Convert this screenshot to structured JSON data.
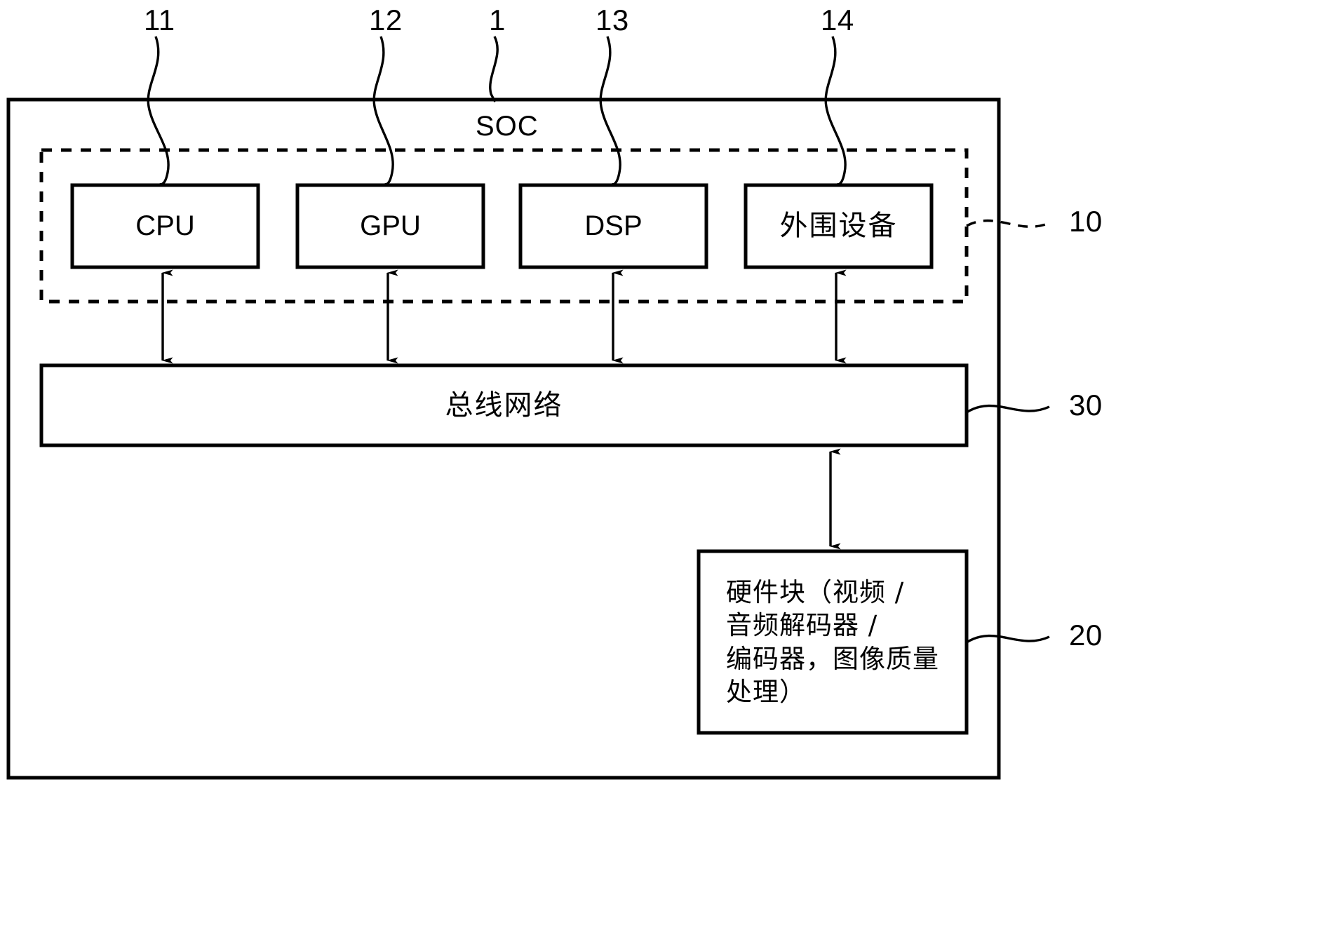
{
  "figure": {
    "title": "SOC",
    "outer_label": "SOC"
  },
  "blocks": {
    "cpu": "CPU",
    "gpu": "GPU",
    "dsp": "DSP",
    "peripheral": "外围设备",
    "bus_network": "总线网络",
    "hardware_block": "硬件块（视频 /\n音频解码器 /\n编码器，图像质量\n处理）"
  },
  "reference_numerals": {
    "top": [
      {
        "id": "11",
        "label": "11",
        "target": "cpu"
      },
      {
        "id": "12",
        "label": "12",
        "target": "gpu"
      },
      {
        "id": "1",
        "label": "1",
        "target": "soc"
      },
      {
        "id": "13",
        "label": "13",
        "target": "dsp"
      },
      {
        "id": "14",
        "label": "14",
        "target": "peripheral"
      }
    ],
    "right": [
      {
        "id": "10",
        "label": "10",
        "target": "processor-group"
      },
      {
        "id": "30",
        "label": "30",
        "target": "bus-network"
      },
      {
        "id": "20",
        "label": "20",
        "target": "hardware-block"
      }
    ]
  },
  "connectors": {
    "cpu_to_bus": "bidirectional",
    "gpu_to_bus": "bidirectional",
    "dsp_to_bus": "bidirectional",
    "peripheral_to_bus": "bidirectional",
    "bus_to_hardware_block": "bidirectional"
  },
  "colors": {
    "line": "#000000",
    "background": "#ffffff"
  }
}
